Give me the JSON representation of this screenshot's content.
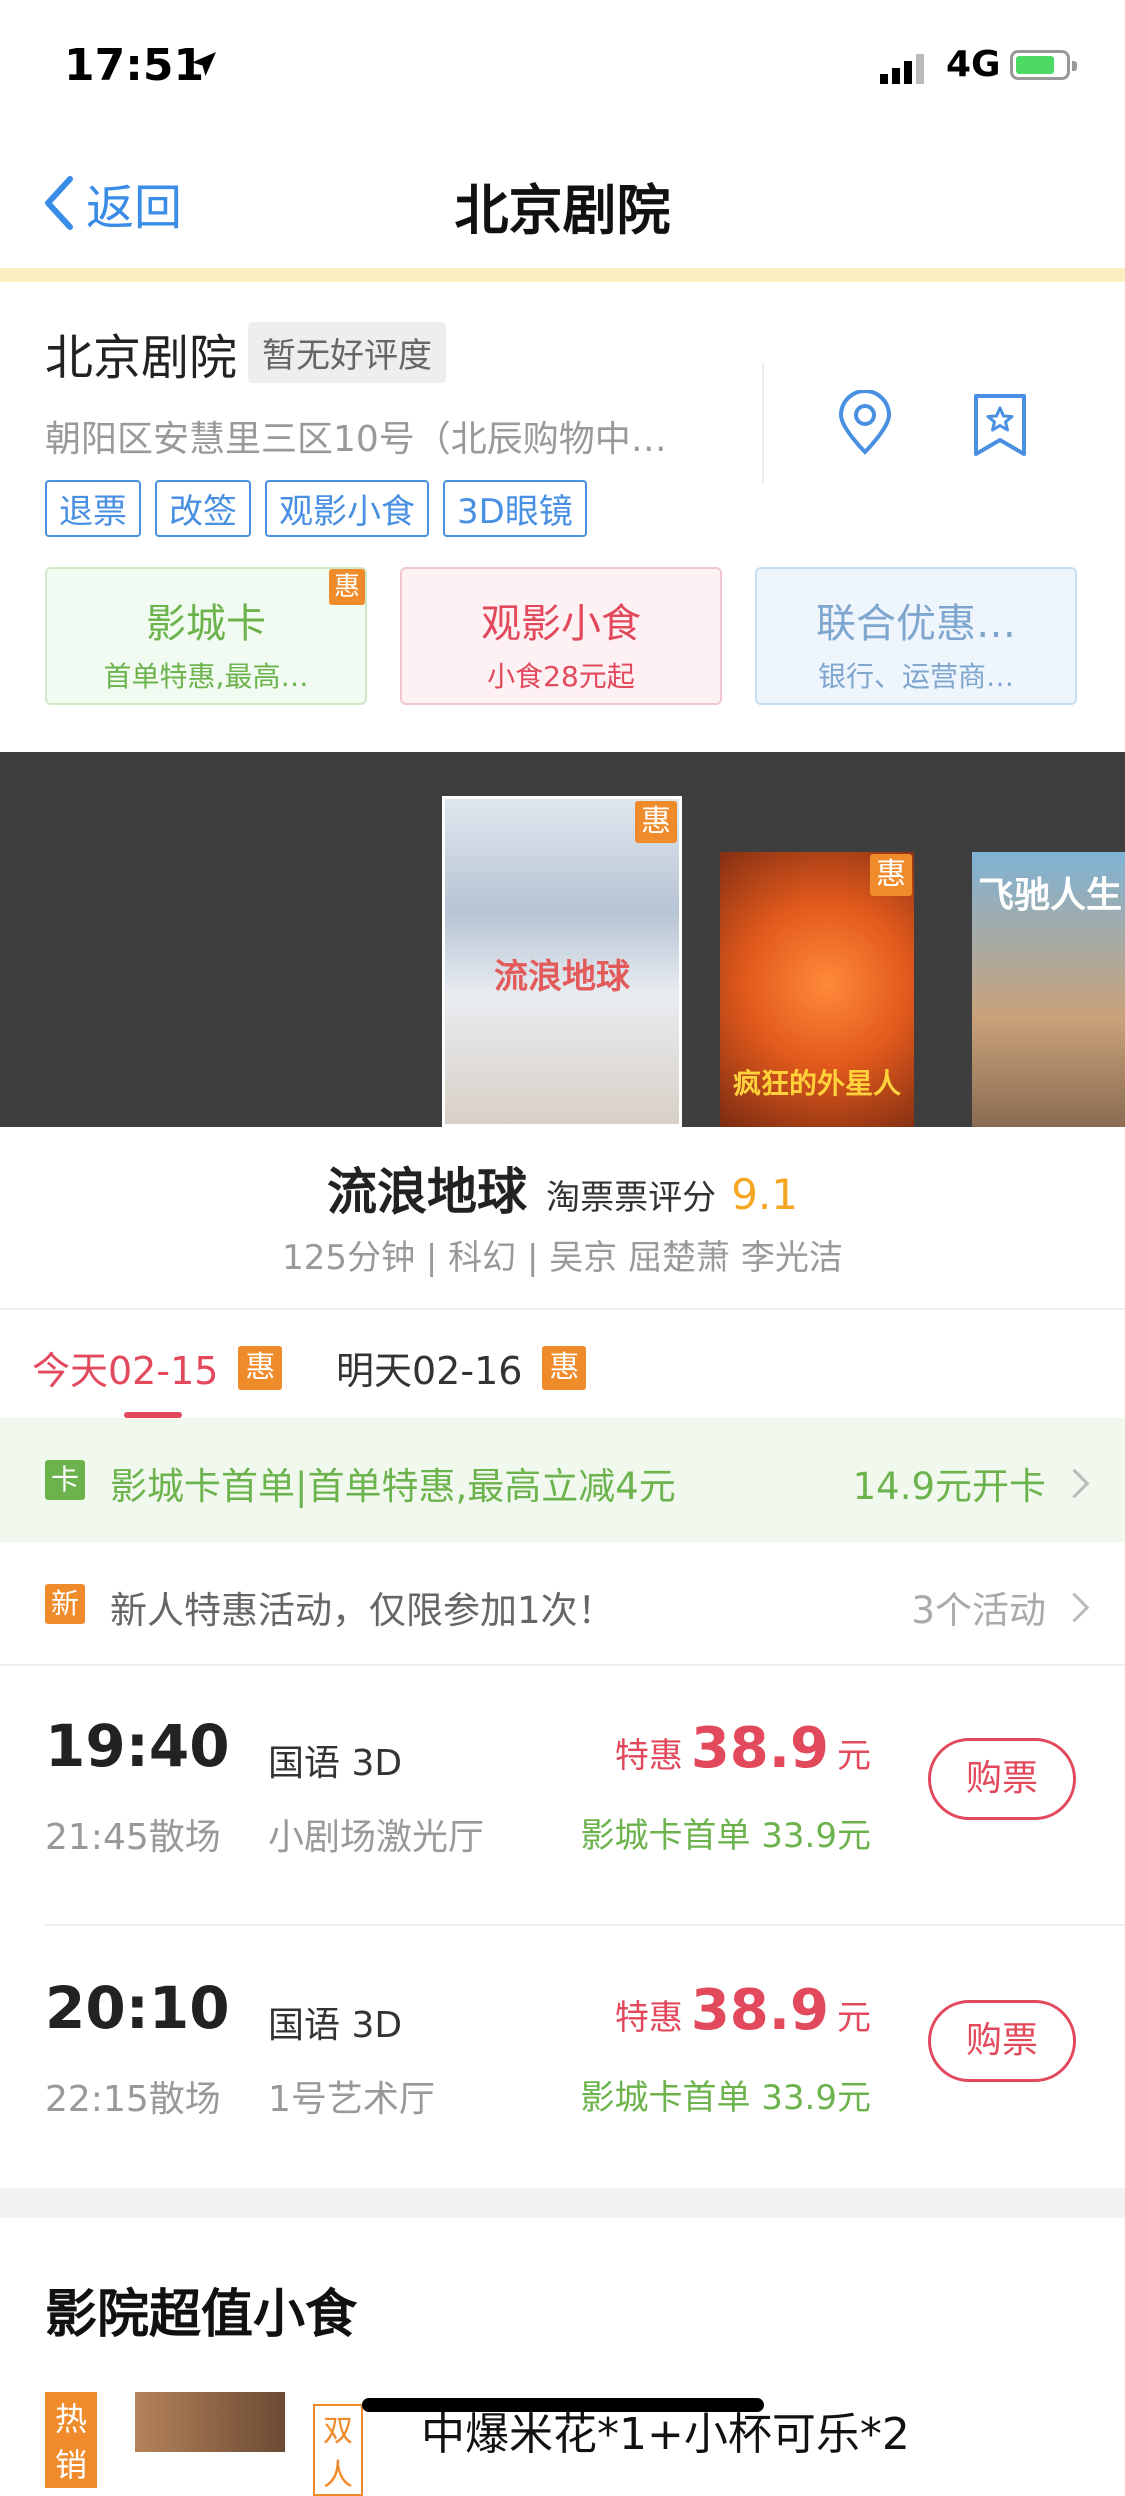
{
  "status_bar": {
    "time": "17:51",
    "network": "4G"
  },
  "nav": {
    "back_label": "返回",
    "title": "北京剧院"
  },
  "cinema": {
    "name": "北京剧院",
    "rating_badge": "暂无好评度",
    "address": "朝阳区安慧里三区10号（北辰购物中…",
    "tags": [
      "退票",
      "改签",
      "观影小食",
      "3D眼镜"
    ]
  },
  "promo_cards": [
    {
      "title": "影城卡",
      "subtitle": "首单特惠,最高…",
      "badge": "惠"
    },
    {
      "title": "观影小食",
      "subtitle": "小食28元起"
    },
    {
      "title": "联合优惠…",
      "subtitle": "银行、运营商…"
    }
  ],
  "posters": [
    {
      "badge": "惠",
      "title_text": "流浪地球"
    },
    {
      "badge": "惠",
      "title_text": "疯狂的外星人"
    },
    {
      "title_text": "飞驰人生"
    }
  ],
  "movie": {
    "title": "流浪地球",
    "rating_label": "淘票票评分",
    "rating": "9.1",
    "desc": "125分钟 | 科幻 | 吴京 屈楚萧 李光洁"
  },
  "date_tabs": [
    {
      "label": "今天02-15",
      "badge": "惠"
    },
    {
      "label": "明天02-16",
      "badge": "惠"
    }
  ],
  "promo_rows": [
    {
      "badge": "卡",
      "text": "影城卡首单|首单特惠,最高立减4元",
      "right": "14.9元开卡"
    },
    {
      "badge": "新",
      "text": "新人特惠活动，仅限参加1次！",
      "right": "3个活动"
    }
  ],
  "showtimes": [
    {
      "start": "19:40",
      "end": "21:45散场",
      "lang": "国语 3D",
      "hall": "小剧场激光厅",
      "price_label": "特惠",
      "price": "38.9",
      "unit": "元",
      "card_price": "影城卡首单 33.9元",
      "buy": "购票"
    },
    {
      "start": "20:10",
      "end": "22:15散场",
      "lang": "国语 3D",
      "hall": "1号艺术厅",
      "price_label": "特惠",
      "price": "38.9",
      "unit": "元",
      "card_price": "影城卡首单 33.9元",
      "buy": "购票"
    }
  ],
  "snacks": {
    "title": "影院超值小食",
    "first": {
      "badge": "热销",
      "tag": "双人",
      "name": "中爆米花*1+小杯可乐*2"
    }
  },
  "colors": {
    "accent_red": "#e2495c",
    "link_blue": "#3a8de6",
    "green": "#6cb34d",
    "orange": "#f08b2c"
  }
}
